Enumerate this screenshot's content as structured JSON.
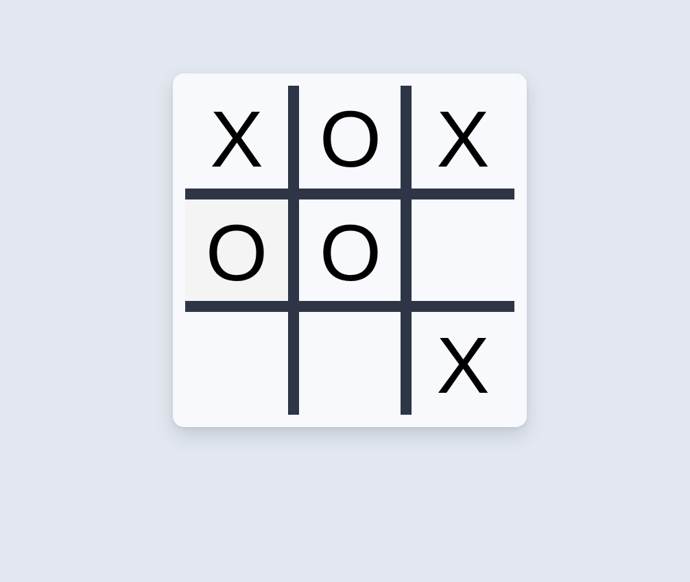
{
  "board": {
    "cells": [
      [
        "X",
        "O",
        "X"
      ],
      [
        "O",
        "O",
        ""
      ],
      [
        "",
        "",
        "X"
      ]
    ],
    "highlighted_cell": "row 2, column 1"
  },
  "colors": {
    "background": "#e3e8f0",
    "card": "#f8f9fc",
    "grid_lines": "#2d3546",
    "marks": "#000000",
    "hover_cell": "#f4f4f5"
  }
}
